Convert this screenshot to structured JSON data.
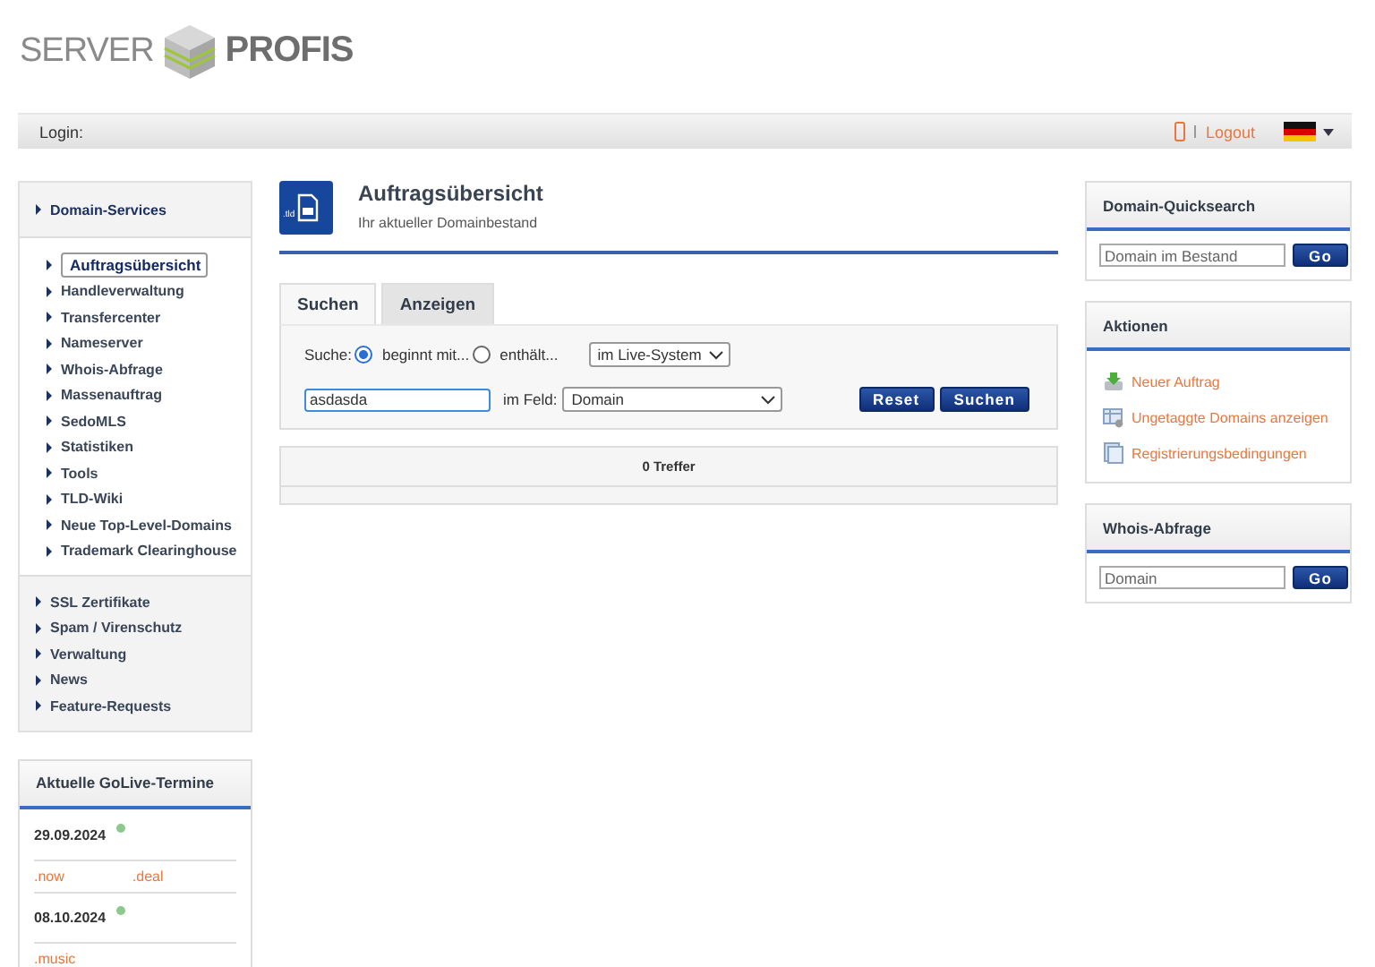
{
  "logo": {
    "word_1": "SERVER",
    "word_2": "PROFIS"
  },
  "top_bar": {
    "login_label": "Login:",
    "logout": "Logout"
  },
  "sidebar": {
    "header": "Domain-Services",
    "items": [
      {
        "label": "Auftragsübersicht",
        "selected": true
      },
      {
        "label": "Handleverwaltung",
        "selected": false
      },
      {
        "label": "Transfercenter",
        "selected": false
      },
      {
        "label": "Nameserver",
        "selected": false
      },
      {
        "label": "Whois-Abfrage",
        "selected": false
      },
      {
        "label": "Massenauftrag",
        "selected": false
      },
      {
        "label": "SedoMLS",
        "selected": false
      },
      {
        "label": "Statistiken",
        "selected": false
      },
      {
        "label": "Tools",
        "selected": false
      },
      {
        "label": "TLD-Wiki",
        "selected": false
      },
      {
        "label": "Neue Top-Level-Domains",
        "selected": false
      },
      {
        "label": "Trademark Clearinghouse",
        "selected": false
      }
    ],
    "more_items": [
      "SSL Zertifikate",
      "Spam / Virenschutz",
      "Verwaltung",
      "News",
      "Feature-Requests"
    ]
  },
  "golive": {
    "title": "Aktuelle GoLive-Termine",
    "entries": [
      {
        "date": "29.09.2024",
        "color": "#8cc98c",
        "tlds": [
          ".now",
          ".deal"
        ]
      },
      {
        "date": "08.10.2024",
        "color": "#8cc98c",
        "tlds": [
          ".music"
        ]
      }
    ]
  },
  "page_header": {
    "icon_label": ".tld",
    "title": "Auftragsübersicht",
    "subtitle": "Ihr aktueller Domainbestand"
  },
  "tabs": [
    {
      "label": "Suchen",
      "selected": true
    },
    {
      "label": "Anzeigen",
      "selected": false
    }
  ],
  "search_form": {
    "label": "Suche:",
    "options": [
      {
        "label": "beginnt mit...",
        "selected": true
      },
      {
        "label": "enthält...",
        "selected": false
      }
    ],
    "system_select": "im Live-System",
    "query": "asdasda",
    "field_label": "im Feld:",
    "field_select": "Domain",
    "buttons": [
      "Reset",
      "Suchen"
    ]
  },
  "results": {
    "count": "0 Treffer"
  },
  "quicksearch": {
    "title": "Domain-Quicksearch",
    "placeholder": "Domain im Bestand",
    "button": "Go"
  },
  "actions": {
    "title": "Aktionen",
    "items": [
      {
        "kind": "new",
        "label": "Neuer Auftrag"
      },
      {
        "kind": "table",
        "label": "Ungetaggte Domains anzeigen"
      },
      {
        "kind": "document",
        "label": "Registrierungsbedingungen"
      }
    ]
  },
  "whois": {
    "title": "Whois-Abfrage",
    "placeholder": "Domain",
    "button": "Go"
  }
}
